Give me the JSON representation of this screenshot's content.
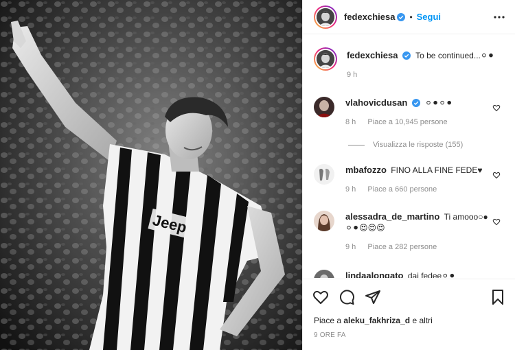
{
  "post": {
    "author": "fedexchiesa",
    "follow_separator": "•",
    "follow_label": "Segui"
  },
  "caption": {
    "author": "fedexchiesa",
    "text": "To be continued...",
    "emoji": "⚪⚫",
    "time": "9 h"
  },
  "comments": [
    {
      "author": "vlahovicdusan",
      "text": "⚪⚫⚪⚫",
      "time": "8 h",
      "likes": "Piace a 10,945 persone",
      "replies": "Visualizza le risposte (155)"
    },
    {
      "author": "mbafozzo",
      "text": "FINO ALLA FINE FEDE",
      "emoji": "♥",
      "time": "9 h",
      "likes": "Piace a 660 persone"
    },
    {
      "author": "alessadra_de_martino",
      "text": "Ti amooo",
      "emoji_line1": "○●",
      "emoji_line2": "⚪⚫😍😍😍",
      "time": "9 h",
      "likes": "Piace a 282 persone"
    },
    {
      "author": "lindaalongato",
      "text": "dai fedee",
      "emoji": "⚪⚫"
    }
  ],
  "actions": {
    "like_icon": "heart-icon",
    "comment_icon": "comment-icon",
    "share_icon": "send-icon",
    "save_icon": "bookmark-icon"
  },
  "likes_line": {
    "prefix": "Piace a",
    "user": "aleku_fakhriza_d",
    "suffix": "e altri"
  },
  "posted_ago": "9 ORE FA",
  "colors": {
    "link": "#0095f6",
    "verified": "#3897f0",
    "muted": "#8e8e8e",
    "text": "#262626"
  }
}
